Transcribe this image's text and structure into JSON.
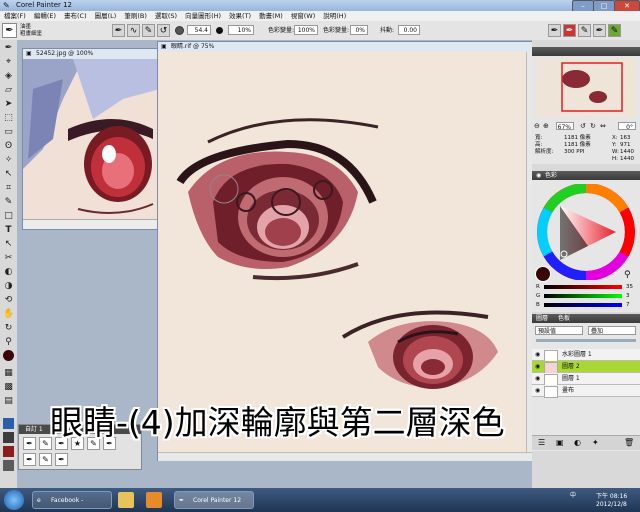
{
  "window": {
    "title": "Corel Painter 12"
  },
  "menu": [
    "檔案(F)",
    "編輯(E)",
    "畫布(C)",
    "圖層(L)",
    "筆刷(B)",
    "選取(S)",
    "向量圖形(H)",
    "效果(T)",
    "動畫(M)",
    "視窗(W)",
    "說明(H)"
  ],
  "propbar": {
    "brush_category": "油墨",
    "brush_variant": "粗畫細塗",
    "size_value": "54.4",
    "opacity_value": "10%",
    "color_var_label": "色彩變量:",
    "color_var_value": "100%",
    "color_var2_label": "色彩變量:",
    "color_var2_value": "0%",
    "jitter_label": "抖動:",
    "jitter_value": "0.00"
  },
  "reference_window": {
    "title": "52452.jpg @ 100%"
  },
  "canvas_window": {
    "title": "眼睛.rif @ 75%"
  },
  "navigator": {
    "zoom": "67%",
    "angle": "0°",
    "info": {
      "w_label": "寬:",
      "w_value": "1181 像素",
      "h_label": "高:",
      "h_value": "1181 像素",
      "res_label": "解析度:",
      "res_value": "300 PPI",
      "x_label": "X:",
      "x_value": "163",
      "y_label": "Y:",
      "y_value": "971",
      "w2_label": "W:",
      "w2_value": "1440",
      "h2_label": "H:",
      "h2_value": "1440"
    }
  },
  "color_panel": {
    "title": "色彩",
    "r_label": "R",
    "r_value": "35",
    "g_label": "G",
    "g_value": "3",
    "b_label": "B",
    "b_value": "7",
    "current_color": "#3a0508"
  },
  "layers_panel": {
    "tab1": "圖層",
    "tab2": "色板",
    "composite": "預設值",
    "blend": "疊加",
    "layers": [
      {
        "name": "水彩圖層 1",
        "selected": false
      },
      {
        "name": "圖層 2",
        "selected": true
      },
      {
        "name": "圖層 1",
        "selected": false
      },
      {
        "name": "畫布",
        "selected": false
      }
    ]
  },
  "brush_selector": {
    "label": "自訂 1"
  },
  "caption": "眼睛-(4)加深輪廓與第二層深色",
  "taskbar": {
    "tasks": [
      "Facebook -",
      "Corel Painter 12"
    ],
    "tray_lang": "中",
    "time": "下午 08:16",
    "date": "2012/12/8"
  },
  "colors": {
    "accent_selected_layer": "#a9d834",
    "panel_header": "#4a4a4a"
  }
}
